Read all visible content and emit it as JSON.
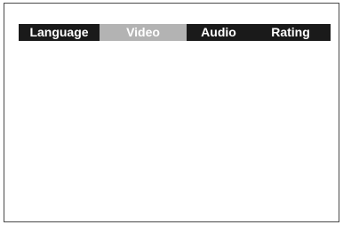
{
  "menu": {
    "tabs": [
      {
        "label": "Language",
        "selected": false
      },
      {
        "label": "Video",
        "selected": true
      },
      {
        "label": "Audio",
        "selected": false
      },
      {
        "label": "Rating",
        "selected": false
      }
    ],
    "colors": {
      "bar_background": "#1a1a1a",
      "selected_tab_background": "#b3b3b3",
      "tab_text": "#ffffff"
    }
  }
}
